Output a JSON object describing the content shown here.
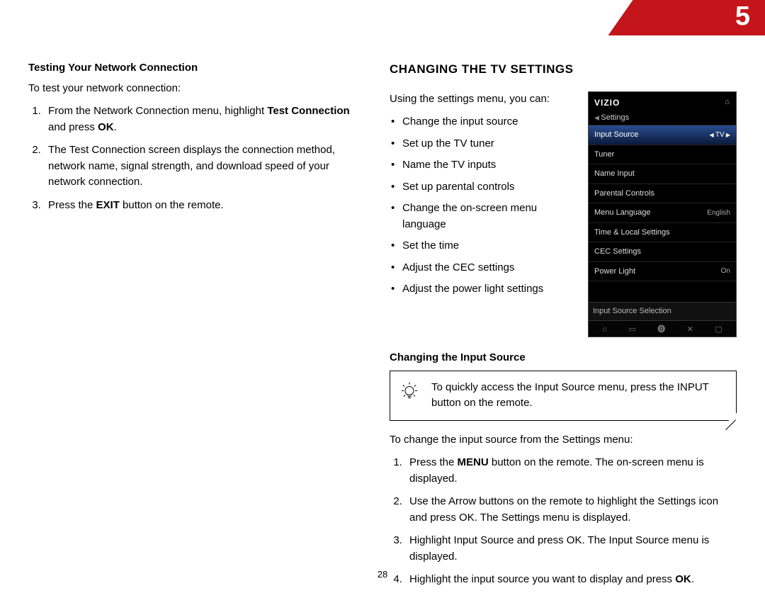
{
  "chapter": {
    "number": "5"
  },
  "page_number": "28",
  "left": {
    "heading": "Testing Your Network Connection",
    "intro": "To test your network connection:",
    "steps": [
      {
        "pre": "From the Network Connection menu, highlight ",
        "bold": "Test Connection",
        "mid": " and press ",
        "bold2": "OK",
        "post": "."
      },
      {
        "plain": "The Test Connection screen displays the connection method, network name, signal strength, and download speed of your network connection."
      },
      {
        "pre": "Press the ",
        "bold": "EXIT",
        "post": " button on the remote."
      }
    ]
  },
  "right": {
    "heading": "CHANGING THE TV SETTINGS",
    "intro": "Using the settings menu, you can:",
    "bullets": [
      "Change the input source",
      "Set up the TV tuner",
      "Name the TV inputs",
      "Set up parental controls",
      "Change the on-screen menu language",
      "Set the time",
      "Adjust the CEC settings",
      "Adjust the power light settings"
    ],
    "tv": {
      "brand": "VIZIO",
      "sub": "Settings",
      "rows": [
        {
          "label": "Input Source",
          "value": "TV",
          "selected": true
        },
        {
          "label": "Tuner",
          "value": ""
        },
        {
          "label": "Name Input",
          "value": ""
        },
        {
          "label": "Parental Controls",
          "value": ""
        },
        {
          "label": "Menu Language",
          "value": "English"
        },
        {
          "label": "Time & Local Settings",
          "value": ""
        },
        {
          "label": "CEC Settings",
          "value": ""
        },
        {
          "label": "Power Light",
          "value": "On"
        }
      ],
      "footer": "Input Source Selection",
      "controls": [
        "⌂",
        "▭",
        "⓿",
        "✕",
        "▢"
      ]
    },
    "sub_heading": "Changing the Input Source",
    "tip": "To quickly access the Input Source menu, press the INPUT button on the remote.",
    "intro2": "To change the input source from the Settings menu:",
    "steps": [
      {
        "pre": "Press the ",
        "bold": "MENU",
        "post": " button on the remote. The on-screen menu is displayed."
      },
      {
        "plain": "Use the Arrow buttons on the remote to highlight the Settings icon and press OK. The Settings menu is displayed."
      },
      {
        "plain": "Highlight Input Source and press OK. The Input Source menu is displayed."
      },
      {
        "pre": "Highlight the input source you want to display and press ",
        "bold": "OK",
        "post": "."
      }
    ]
  }
}
